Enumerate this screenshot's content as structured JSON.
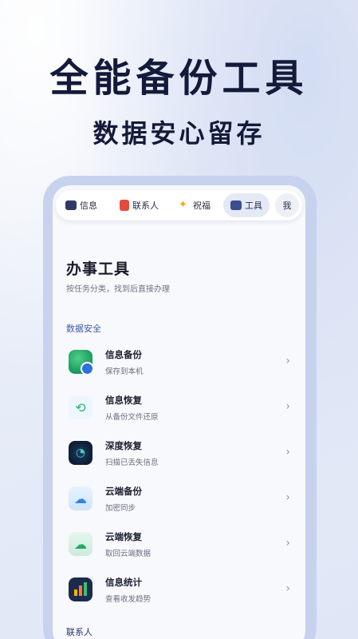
{
  "hero": {
    "title": "全能备份工具",
    "subtitle": "数据安心留存"
  },
  "tabs": [
    {
      "label": "信息",
      "icon": "mail-icon"
    },
    {
      "label": "联系人",
      "icon": "contacts-icon"
    },
    {
      "label": "祝福",
      "icon": "sparkle-icon"
    },
    {
      "label": "工具",
      "icon": "toolbox-icon",
      "active": true
    },
    {
      "label": "我",
      "icon": ""
    }
  ],
  "page": {
    "title": "办事工具",
    "description": "按任务分类，找到后直接办理"
  },
  "sections": [
    {
      "title": "数据安全",
      "items": [
        {
          "label": "信息备份",
          "sub": "保存到本机",
          "icon": "database-backup-icon"
        },
        {
          "label": "信息恢复",
          "sub": "从备份文件还原",
          "icon": "restore-arrow-icon"
        },
        {
          "label": "深度恢复",
          "sub": "扫描已丢失信息",
          "icon": "radar-scan-icon"
        },
        {
          "label": "云端备份",
          "sub": "加密同步",
          "icon": "cloud-upload-icon"
        },
        {
          "label": "云端恢复",
          "sub": "取回云端数据",
          "icon": "cloud-download-icon"
        },
        {
          "label": "信息统计",
          "sub": "查看收发趋势",
          "icon": "bar-chart-icon"
        }
      ]
    },
    {
      "title": "联系人",
      "items": []
    }
  ],
  "chevron": "›",
  "colors": {
    "accent": "#3d57a8",
    "title": "#131a3a",
    "phone_frame": "#c7d2ee"
  }
}
